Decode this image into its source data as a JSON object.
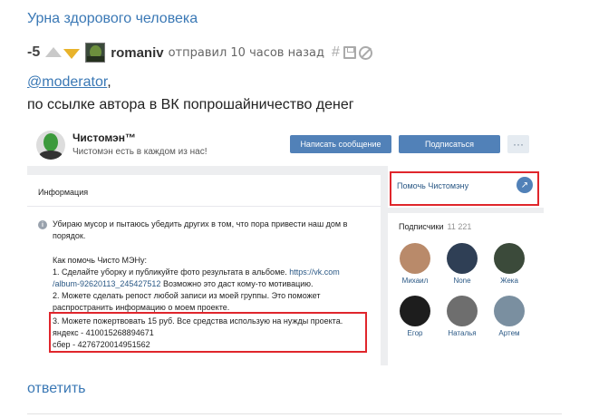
{
  "post": {
    "title": "Урна здорового человека",
    "score": "-5",
    "author": "romaniv",
    "meta": "отправил 10 часов назад",
    "hash_symbol": "#",
    "mention": "@moderator",
    "mention_suffix": ",",
    "text": "по ссылке автора в ВК попрошайничество денег",
    "reply_label": "ответить",
    "icons": [
      "vote-up-icon",
      "vote-down-icon",
      "hash-icon",
      "save-icon",
      "ban-icon"
    ],
    "colors": {
      "link": "#3a78b5",
      "vote_down": "#e8b32b"
    }
  },
  "embed": {
    "group_name": "Чистомэн™",
    "group_status": "Чистомэн есть в каждом из нас!",
    "message_button": "Написать сообщение",
    "subscribe_button": "Подписаться",
    "more_button": "···",
    "info_tab": "Информация",
    "info_paragraph": "Убираю мусор и пытаюсь убедить других в том, что пора привести наш дом в порядок.",
    "help_header": "Как помочь Чисто МЭНу:",
    "step1_a": "1. Сделайте уборку и публикуйте фото результата в альбоме.",
    "step1_link_a": "https://vk.com",
    "step1_link_b": "/album-92620113_245427512",
    "step1_b": "Возможно это даст кому-то мотивацию.",
    "step2_a": "2. Можете сделать репост любой записи из моей группы. Это поможет",
    "step2_b": "распространить информацию о моем проекте.",
    "step3": "3. Можете пожертвовать 15 руб. Все средства использую на нужды проекта.",
    "yandex": "яндекс - 410015268894671",
    "sber": "сбер - 4276720014951562",
    "help_link": "Помочь Чистомэну",
    "subscribers_label": "Подписчики",
    "subscribers_count": "11 221",
    "subscribers": [
      {
        "name": "Михаил",
        "color": "#b98a6a"
      },
      {
        "name": "None",
        "color": "#2f3f55"
      },
      {
        "name": "Жека",
        "color": "#3b4a3a"
      },
      {
        "name": "Егор",
        "color": "#1d1d1d"
      },
      {
        "name": "Наталья",
        "color": "#6e6e6e"
      },
      {
        "name": "Артем",
        "color": "#7a8fa0"
      }
    ],
    "colors": {
      "vk_blue": "#5181b8",
      "highlight_red": "#e0262c"
    }
  }
}
